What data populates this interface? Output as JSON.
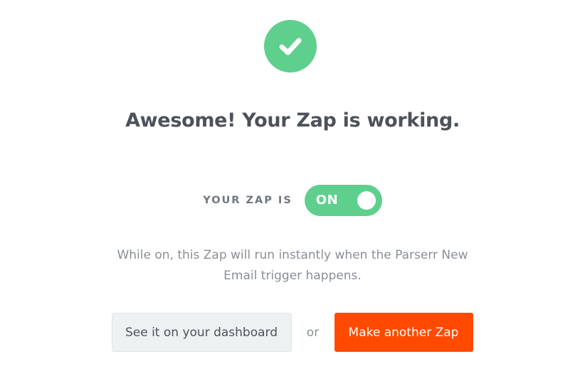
{
  "success": {
    "icon": "checkmark-icon",
    "headline": "Awesome! Your Zap is working."
  },
  "status": {
    "label": "YOUR ZAP IS",
    "toggle_text": "ON",
    "toggle_state": "on"
  },
  "description": {
    "line1": "While on, this Zap will run instantly when the Parserr New",
    "line2": "Email trigger happens."
  },
  "actions": {
    "dashboard_label": "See it on your dashboard",
    "separator": "or",
    "make_another_label": "Make another Zap"
  },
  "colors": {
    "success_green": "#5fcf8e",
    "primary_orange": "#ff4a00",
    "heading_text": "#4d525a",
    "muted_text": "#8a8f96",
    "secondary_bg": "#eef1f2"
  }
}
